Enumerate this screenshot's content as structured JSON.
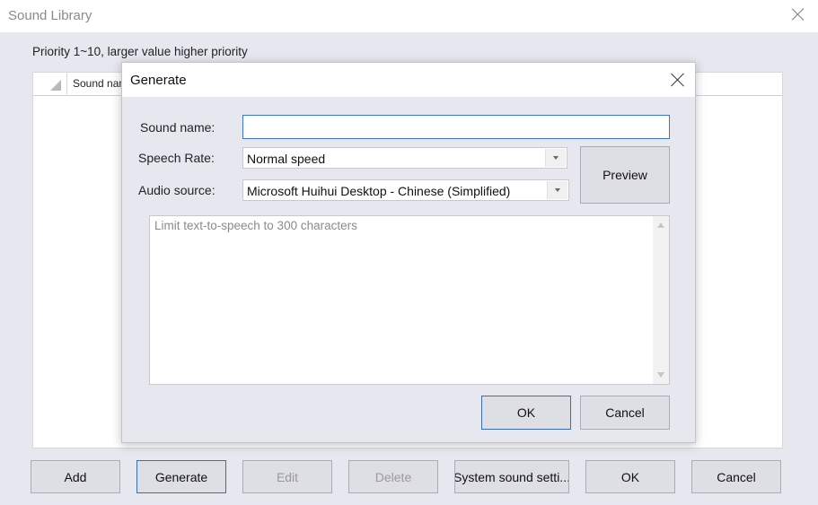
{
  "main_window": {
    "title": "Sound Library",
    "priority_hint": "Priority 1~10, larger value higher priority",
    "list": {
      "columns": [
        "Sound nam"
      ]
    },
    "buttons": {
      "add": "Add",
      "generate": "Generate",
      "edit": "Edit",
      "delete": "Delete",
      "system_sound_settings": "System sound setti...",
      "ok": "OK",
      "cancel": "Cancel"
    }
  },
  "generate_dialog": {
    "title": "Generate",
    "sound_name": {
      "label": "Sound name:",
      "value": ""
    },
    "speech_rate": {
      "label": "Speech Rate:",
      "selected": "Normal speed"
    },
    "audio_source": {
      "label": "Audio source:",
      "selected": "Microsoft Huihui Desktop - Chinese (Simplified)"
    },
    "preview_label": "Preview",
    "tts_text": {
      "value": "",
      "placeholder": "Limit text-to-speech to 300 characters"
    },
    "ok_label": "OK",
    "cancel_label": "Cancel"
  }
}
